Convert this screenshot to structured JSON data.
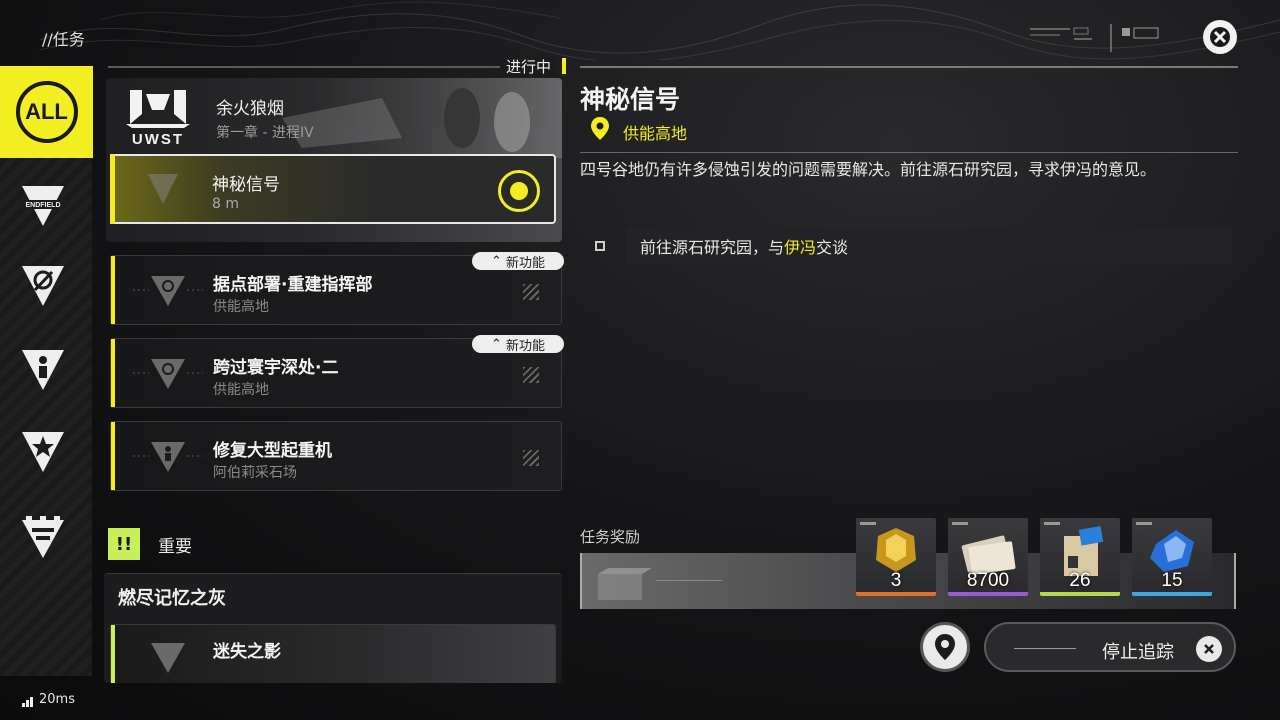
{
  "header": {
    "breadcrumb": "//任务"
  },
  "rail": {
    "all_label": "ALL",
    "items": [
      {
        "name": "endfield",
        "label": "ENDFIELD"
      },
      {
        "name": "explore"
      },
      {
        "name": "character"
      },
      {
        "name": "star"
      },
      {
        "name": "battery"
      }
    ]
  },
  "quest_list": {
    "ongoing_label": "进行中",
    "chapter": {
      "logo": "UWST",
      "title": "余火狼烟",
      "subtitle": "第一章 - 进程IV"
    },
    "active": {
      "title": "神秘信号",
      "distance": "8 m"
    },
    "items": [
      {
        "title": "据点部署·重建指挥部",
        "location": "供能高地",
        "badge": "新功能"
      },
      {
        "title": "跨过寰宇深处·二",
        "location": "供能高地",
        "badge": "新功能"
      },
      {
        "title": "修复大型起重机",
        "location": "阿伯莉采石场",
        "badge": ""
      }
    ],
    "important": {
      "icon": "!!",
      "label": "重要",
      "card_title": "燃尽记忆之灰",
      "quest_title": "迷失之影"
    }
  },
  "detail": {
    "title": "神秘信号",
    "location": "供能高地",
    "description": "四号谷地仍有许多侵蚀引发的问题需要解决。前往源石研究园，寻求伊冯的意见。",
    "objective_prefix": "前往源石研究园，与",
    "objective_highlight": "伊冯",
    "objective_suffix": "交谈"
  },
  "rewards": {
    "label": "任务奖励",
    "items": [
      {
        "name": "gold-crystal",
        "count": "3",
        "rim": "#e0702a"
      },
      {
        "name": "credits",
        "count": "8700",
        "rim": "#9b59d6"
      },
      {
        "name": "exp-record",
        "count": "26",
        "rim": "#b6d84a"
      },
      {
        "name": "blue-crystal",
        "count": "15",
        "rim": "#3aa8e6"
      }
    ]
  },
  "actions": {
    "stop_tracking": "停止追踪"
  },
  "status": {
    "ping": "20ms"
  },
  "colors": {
    "accent": "#f2ee22",
    "important": "#c9f05a"
  }
}
